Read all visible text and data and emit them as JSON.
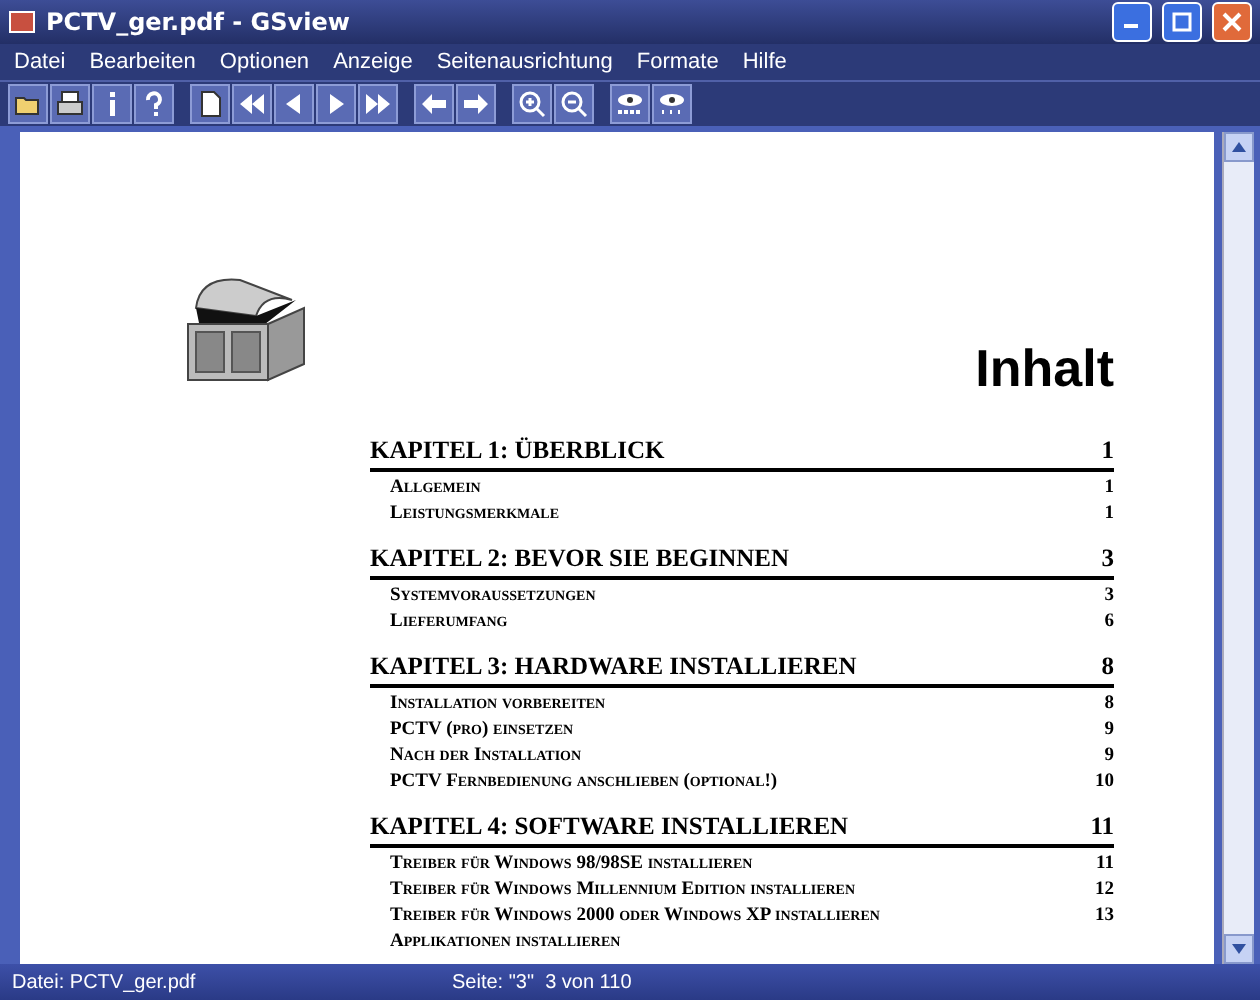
{
  "window": {
    "title": "PCTV_ger.pdf - GSview"
  },
  "menu": [
    "Datei",
    "Bearbeiten",
    "Optionen",
    "Anzeige",
    "Seitenausrichtung",
    "Formate",
    "Hilfe"
  ],
  "toolbar": [
    {
      "kind": "open"
    },
    {
      "kind": "print"
    },
    {
      "kind": "info"
    },
    {
      "kind": "help"
    },
    {
      "kind": "sep"
    },
    {
      "kind": "goto"
    },
    {
      "kind": "first"
    },
    {
      "kind": "prev"
    },
    {
      "kind": "next"
    },
    {
      "kind": "last"
    },
    {
      "kind": "sep"
    },
    {
      "kind": "back"
    },
    {
      "kind": "forward"
    },
    {
      "kind": "sep"
    },
    {
      "kind": "zoomin"
    },
    {
      "kind": "zoomout"
    },
    {
      "kind": "sep"
    },
    {
      "kind": "eyeabc"
    },
    {
      "kind": "eyedots"
    }
  ],
  "document": {
    "heading": "Inhalt",
    "chapters": [
      {
        "title": "KAPITEL 1: ÜBERBLICK",
        "page": "1",
        "items": [
          {
            "title": "Allgemein",
            "page": "1"
          },
          {
            "title": "Leistungsmerkmale",
            "page": "1"
          }
        ]
      },
      {
        "title": "KAPITEL 2: BEVOR SIE BEGINNEN",
        "page": "3",
        "items": [
          {
            "title": "Systemvoraussetzungen",
            "page": "3"
          },
          {
            "title": "Lieferumfang",
            "page": "6"
          }
        ]
      },
      {
        "title": "KAPITEL 3: HARDWARE INSTALLIEREN",
        "page": "8",
        "items": [
          {
            "title": "Installation vorbereiten",
            "page": "8"
          },
          {
            "title": "PCTV (pro) einsetzen",
            "page": "9"
          },
          {
            "title": "Nach der Installation",
            "page": "9"
          },
          {
            "title": "PCTV Fernbedienung anschlieben (optional!)",
            "page": "10"
          }
        ]
      },
      {
        "title": "KAPITEL 4: SOFTWARE INSTALLIEREN",
        "page": "11",
        "items": [
          {
            "title": "Treiber für Windows 98/98SE installieren",
            "page": "11"
          },
          {
            "title": "Treiber für Windows Millennium Edition installieren",
            "page": "12"
          },
          {
            "title": "Treiber für Windows 2000 oder Windows XP installieren",
            "page": "13"
          },
          {
            "title": "Applikationen installieren"
          }
        ]
      }
    ]
  },
  "status_bar": {
    "file": "Datei: PCTV_ger.pdf",
    "page": "Seite: \"3\"  3 von 110"
  }
}
